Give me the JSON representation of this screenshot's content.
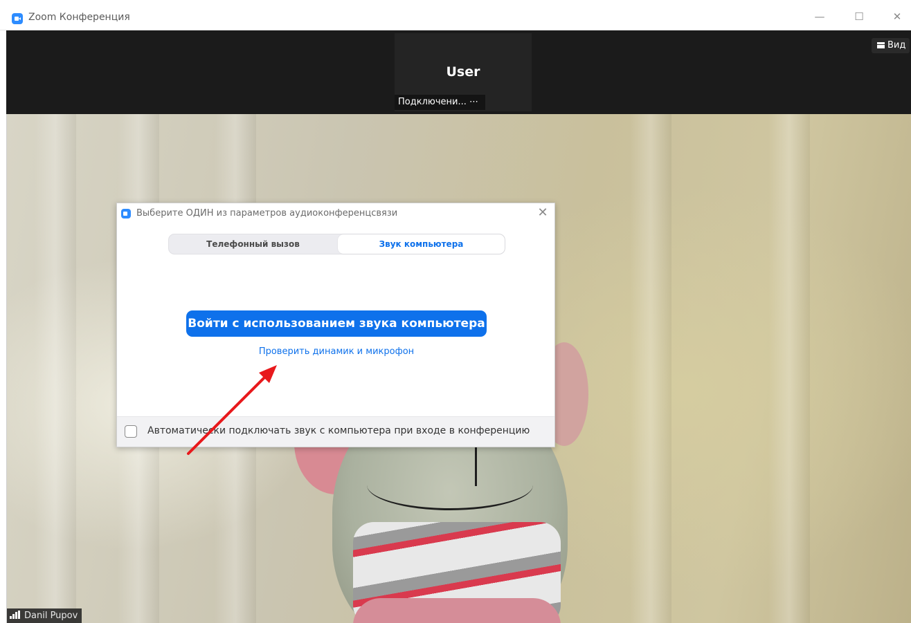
{
  "window": {
    "title": "Zoom Конференция",
    "controls": {
      "minimize": "—",
      "maximize": "☐",
      "close": "✕"
    }
  },
  "meeting": {
    "participant": {
      "name": "User",
      "status": "Подключени... ⋯"
    },
    "view_button": "Вид",
    "self_view_name": "Danil Pupov"
  },
  "dialog": {
    "title": "Выберите ОДИН из параметров аудиоконференцсвязи",
    "tabs": [
      {
        "label": "Телефонный вызов",
        "selected": false
      },
      {
        "label": "Звук компьютера",
        "selected": true
      }
    ],
    "join_button": "Войти с использованием звука компьютера",
    "test_link": "Проверить динамик и микрофон",
    "auto_join_checkbox": {
      "label": "Автоматически подключать звук с компьютера при входе в конференцию",
      "checked": false
    }
  },
  "colors": {
    "accent": "#0e71eb",
    "annotation_arrow": "#e8191c"
  }
}
